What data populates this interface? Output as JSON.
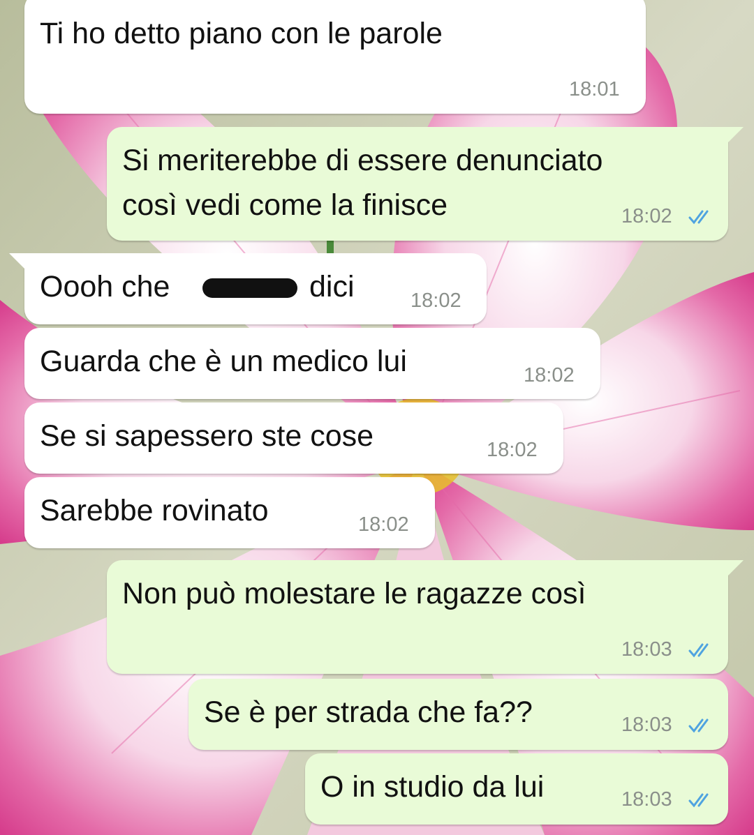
{
  "conversation": {
    "messages": [
      {
        "id": "m1",
        "direction": "incoming",
        "text": "Ti ho detto piano con le parole",
        "time": "18:01"
      },
      {
        "id": "m2",
        "direction": "outgoing",
        "text_line1": "Si meriterebbe di essere denunciato",
        "text_line2": "così vedi come la finisce",
        "time": "18:02",
        "status": "read"
      },
      {
        "id": "m3",
        "direction": "incoming",
        "text_before": "Oooh che",
        "text_after": "dici",
        "censored": true,
        "time": "18:02"
      },
      {
        "id": "m4",
        "direction": "incoming",
        "text": "Guarda che è un medico lui",
        "time": "18:02"
      },
      {
        "id": "m5",
        "direction": "incoming",
        "text": "Se si sapessero ste cose",
        "time": "18:02"
      },
      {
        "id": "m6",
        "direction": "incoming",
        "text": "Sarebbe rovinato",
        "time": "18:02"
      },
      {
        "id": "m7",
        "direction": "outgoing",
        "text": "Non può molestare le ragazze così",
        "time": "18:03",
        "status": "read"
      },
      {
        "id": "m8",
        "direction": "outgoing",
        "text": "Se è per strada che fa??",
        "time": "18:03",
        "status": "read"
      },
      {
        "id": "m9",
        "direction": "outgoing",
        "text": "O in studio da lui",
        "time": "18:03",
        "status": "read"
      }
    ]
  },
  "colors": {
    "incoming_bubble": "#ffffff",
    "outgoing_bubble": "#e9fbd7",
    "read_ticks": "#4fa3e0",
    "wallpaper_petal": "#e0579d",
    "wallpaper_center": "#e8c02a"
  },
  "icons": {
    "read_status": "double-check-icon",
    "wallpaper": "pink-cosmos-flower"
  }
}
